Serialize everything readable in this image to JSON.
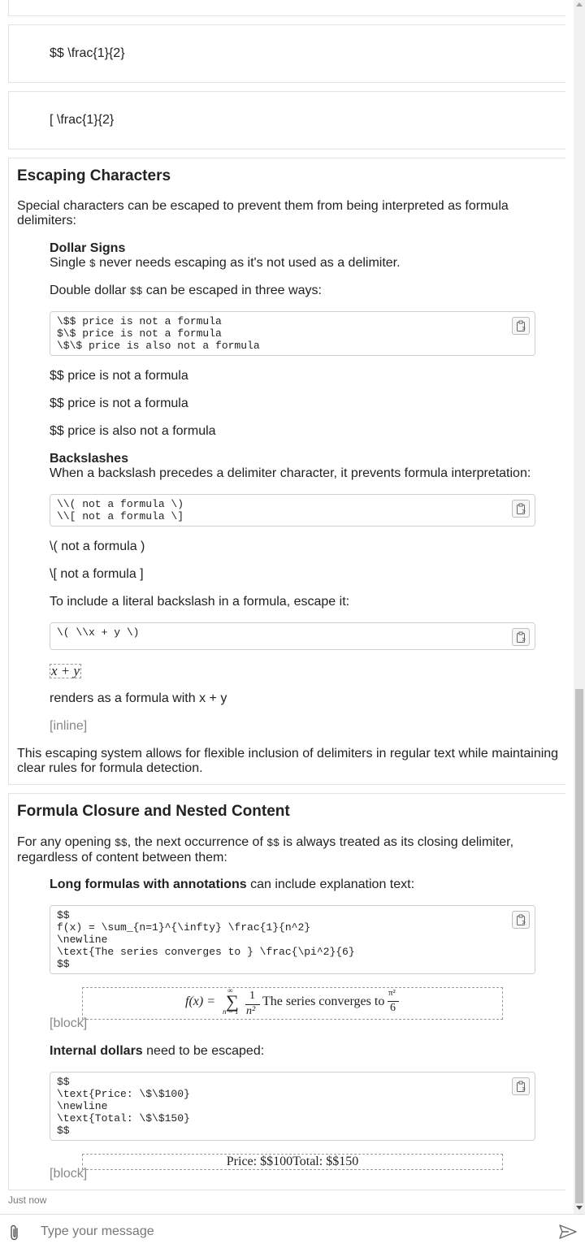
{
  "formula_cards": [
    {
      "raw": "$$ \\frac{1}{2}"
    },
    {
      "raw": "[ \\frac{1}{2}"
    }
  ],
  "escaping": {
    "heading": "Escaping Characters",
    "intro": "Special characters can be escaped to prevent them from being interpreted as formula delimiters:",
    "dollar": {
      "title": "Dollar Signs",
      "single_before": "Single ",
      "single_code": "$",
      "single_after": " never needs escaping as it's not used as a delimiter.",
      "double_before": "Double dollar ",
      "double_code": "$$",
      "double_after": " can be escaped in three ways:",
      "code_lines": "\\$$ price is not a formula\n$\\$ price is not a formula\n\\$\\$ price is also not a formula",
      "results": [
        "$$ price is not a formula",
        "$$ price is not a formula",
        "$$ price is also not a formula"
      ]
    },
    "backslash": {
      "title": "Backslashes",
      "desc": "When a backslash precedes a delimiter character, it prevents formula interpretation:",
      "code_lines": "\\\\( not a formula \\)\n\\\\[ not a formula \\]",
      "results": [
        "\\( not a formula )",
        "\\[ not a formula ]"
      ],
      "literal_desc": "To include a literal backslash in a formula, escape it:",
      "literal_code": "\\( \\\\x + y \\)",
      "rendered": "x + y",
      "renders_as": "renders as a formula with x + y",
      "inline_tag": "[inline]"
    },
    "outro": "This escaping system allows for flexible inclusion of delimiters in regular text while maintaining clear rules for formula detection."
  },
  "closure": {
    "heading": "Formula Closure and Nested Content",
    "intro_a": "For any opening ",
    "intro_code_a": "$$",
    "intro_b": ", the next occurrence of ",
    "intro_code_b": "$$",
    "intro_c": " is always treated as its closing delimiter, regardless of content between them:",
    "long_bold": "Long formulas with annotations",
    "long_rest": " can include explanation text:",
    "long_code": "$$\nf(x) = \\sum_{n=1}^{\\infty} \\frac{1}{n^2}\n\\newline\n\\text{The series converges to } \\frac{\\pi^2}{6}\n$$",
    "long_rendered": {
      "fx": "f(x) =",
      "sum_top": "∞",
      "sum_bottom": "n = 1",
      "frac_num": "1",
      "frac_den": "n²",
      "text": "The series converges to",
      "pi_num": "π²",
      "pi_den": "6"
    },
    "block_tag": "[block]",
    "dollars_bold": "Internal dollars",
    "dollars_rest": " need to be escaped:",
    "dollars_code": "$$\n\\text{Price: \\$\\$100}\n\\newline\n\\text{Total: \\$\\$150}\n$$",
    "dollars_rendered": "Price: $$100Total: $$150",
    "block_tag2": "[block]"
  },
  "timestamp": "Just now",
  "composer": {
    "placeholder": "Type your message",
    "attach_icon": "paperclip-icon",
    "send_icon": "send-icon"
  }
}
